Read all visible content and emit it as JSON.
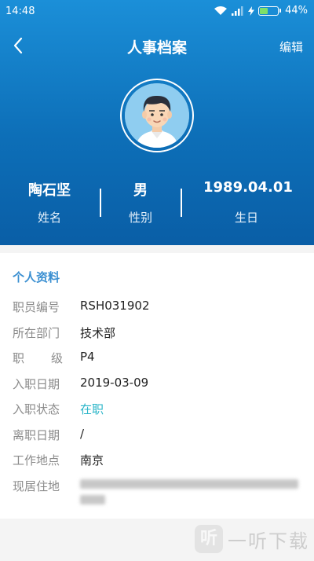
{
  "status_bar": {
    "time": "14:48",
    "battery": "44%",
    "battery_level": 0.44
  },
  "nav": {
    "title": "人事档案",
    "edit": "编辑"
  },
  "profile": {
    "name": "陶石坚",
    "name_label": "姓名",
    "gender": "男",
    "gender_label": "性别",
    "birthday": "1989.04.01",
    "birthday_label": "生日"
  },
  "personal": {
    "title": "个人资料",
    "rows": [
      {
        "label": "职员编号",
        "value": "RSH031902"
      },
      {
        "label": "所在部门",
        "value": "技术部"
      },
      {
        "label": "职级",
        "value": "P4"
      },
      {
        "label": "入职日期",
        "value": "2019-03-09"
      },
      {
        "label": "入职状态",
        "value": "在职"
      },
      {
        "label": "离职日期",
        "value": "/"
      },
      {
        "label": "工作地点",
        "value": "南京"
      },
      {
        "label": "现居住地",
        "value": ""
      }
    ]
  },
  "watermark": {
    "icon": "听",
    "text": "一听下载"
  }
}
